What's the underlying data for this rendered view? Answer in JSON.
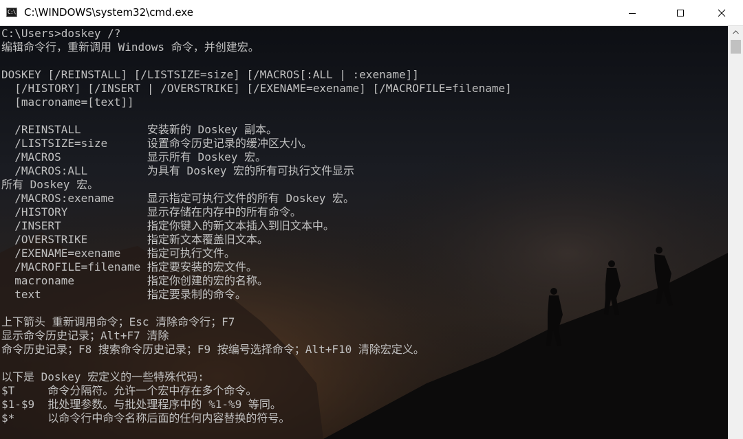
{
  "window": {
    "title": "C:\\WINDOWS\\system32\\cmd.exe",
    "icon": "cmd-icon",
    "icon_glyph": "C:\\",
    "controls": [
      "minimize-icon",
      "maximize-icon",
      "close-icon"
    ]
  },
  "console": {
    "lines": [
      "C:\\Users>doskey /?",
      "编辑命令行，重新调用 Windows 命令，并创建宏。",
      "",
      "DOSKEY [/REINSTALL] [/LISTSIZE=size] [/MACROS[:ALL | :exename]]",
      "  [/HISTORY] [/INSERT | /OVERSTRIKE] [/EXENAME=exename] [/MACROFILE=filename]",
      "  [macroname=[text]]",
      "",
      "  /REINSTALL          安装新的 Doskey 副本。",
      "  /LISTSIZE=size      设置命令历史记录的缓冲区大小。",
      "  /MACROS             显示所有 Doskey 宏。",
      "  /MACROS:ALL         为具有 Doskey 宏的所有可执行文件显示",
      "所有 Doskey 宏。",
      "  /MACROS:exename     显示指定可执行文件的所有 Doskey 宏。",
      "  /HISTORY            显示存储在内存中的所有命令。",
      "  /INSERT             指定你键入的新文本插入到旧文本中。",
      "  /OVERSTRIKE         指定新文本覆盖旧文本。",
      "  /EXENAME=exename    指定可执行文件。",
      "  /MACROFILE=filename 指定要安装的宏文件。",
      "  macroname           指定你创建的宏的名称。",
      "  text                指定要录制的命令。",
      "",
      "上下箭头 重新调用命令；Esc 清除命令行；F7",
      "显示命令历史记录；Alt+F7 清除",
      "命令历史记录；F8 搜索命令历史记录；F9 按编号选择命令；Alt+F10 清除宏定义。",
      "",
      "以下是 Doskey 宏定义的一些特殊代码:",
      "$T     命令分隔符。允许一个宏中存在多个命令。",
      "$1-$9  批处理参数。与批处理程序中的 %1-%9 等同。",
      "$*     以命令行中命令名称后面的任何内容替换的符号。"
    ]
  },
  "colors": {
    "text": "#c0c0c0",
    "titlebar_bg": "#ffffff",
    "console_bg": "#000000",
    "scrollbar_bg": "#f0f0f0",
    "scroll_thumb": "#c1c1c1"
  }
}
